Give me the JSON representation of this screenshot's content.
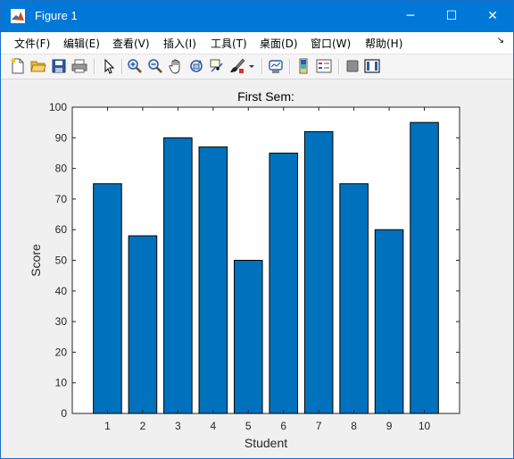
{
  "window": {
    "title": "Figure 1",
    "controls": {
      "minimize": "─",
      "maximize": "☐",
      "close": "✕"
    }
  },
  "menu": {
    "items": [
      "文件(F)",
      "编辑(E)",
      "查看(V)",
      "插入(I)",
      "工具(T)",
      "桌面(D)",
      "窗口(W)",
      "帮助(H)"
    ],
    "overflow_glyph": "↘"
  },
  "toolbar": {
    "icons": [
      "new-figure-icon",
      "open-file-icon",
      "save-icon",
      "print-icon",
      "select-pointer-icon",
      "zoom-in-icon",
      "zoom-out-icon",
      "pan-hand-icon",
      "rotate-3d-icon",
      "data-cursor-icon",
      "brush-icon",
      "brush-dropdown-icon",
      "link-plot-icon",
      "insert-colorbar-icon",
      "insert-legend-icon",
      "hide-plot-tools-icon",
      "show-plot-tools-icon"
    ]
  },
  "colors": {
    "bar": "#0072bd",
    "titlebar": "#0078d7"
  },
  "chart_data": {
    "type": "bar",
    "title": "First Sem:",
    "xlabel": "Student",
    "ylabel": "Score",
    "categories": [
      "1",
      "2",
      "3",
      "4",
      "5",
      "6",
      "7",
      "8",
      "9",
      "10"
    ],
    "values": [
      75,
      58,
      90,
      87,
      50,
      85,
      92,
      75,
      60,
      95
    ],
    "ylim": [
      0,
      100
    ],
    "yticks": [
      0,
      10,
      20,
      30,
      40,
      50,
      60,
      70,
      80,
      90,
      100
    ],
    "grid": false,
    "legend": "none"
  }
}
